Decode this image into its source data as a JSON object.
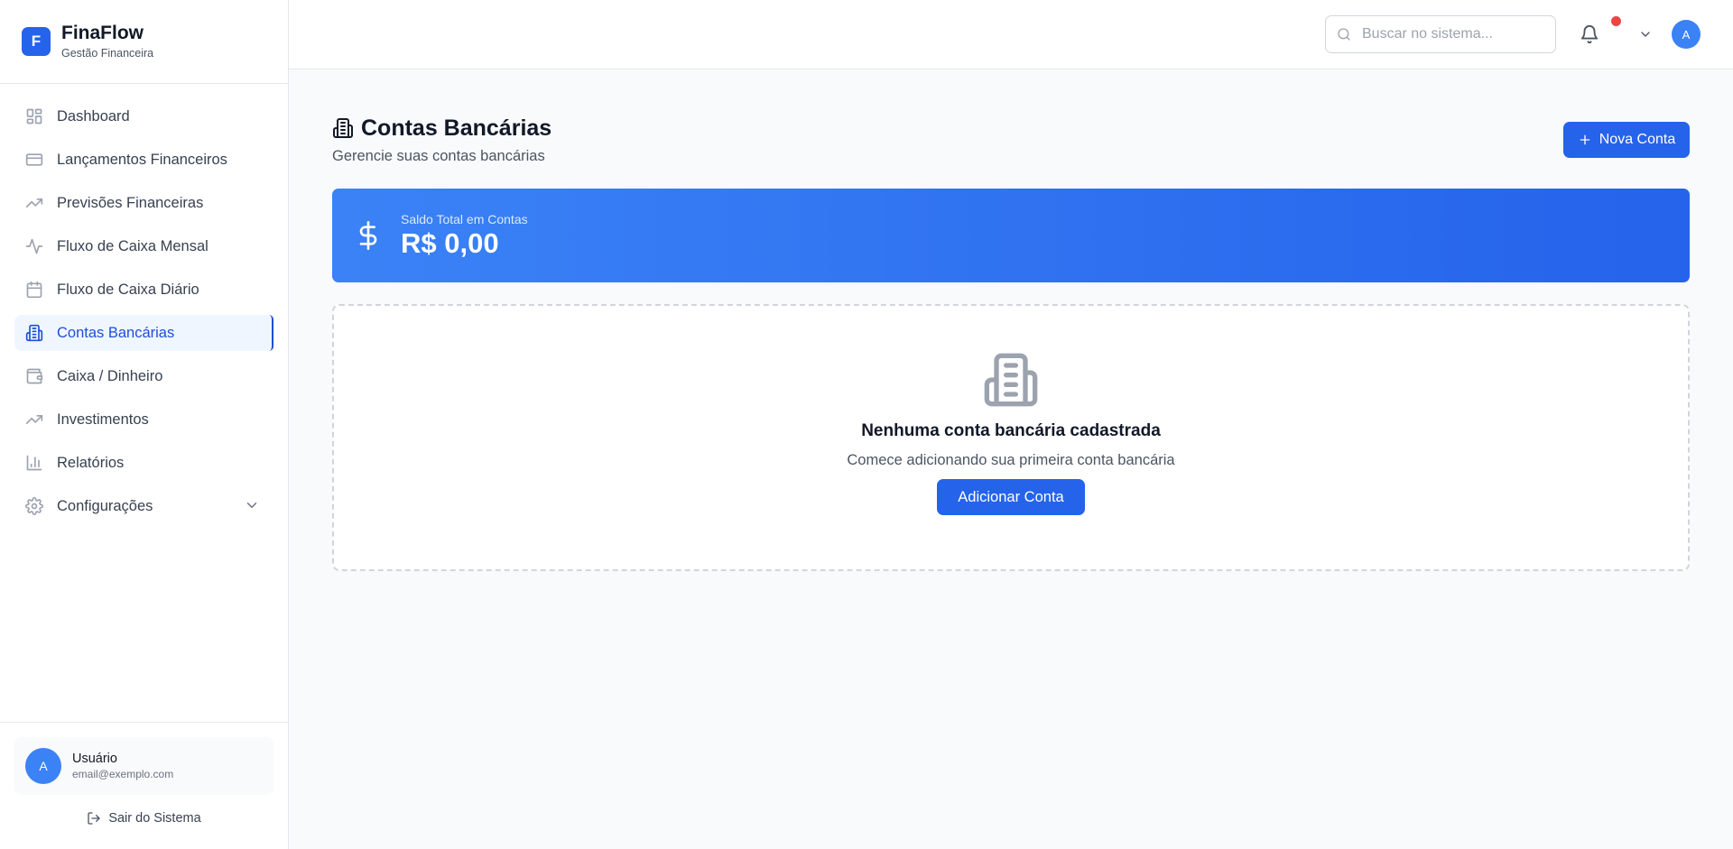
{
  "brand": {
    "logo_letter": "F",
    "name": "FinaFlow",
    "subtitle": "Gestão Financeira"
  },
  "sidebar": {
    "items": [
      {
        "label": "Dashboard",
        "icon": "dashboard-icon"
      },
      {
        "label": "Lançamentos Financeiros",
        "icon": "credit-card-icon"
      },
      {
        "label": "Previsões Financeiras",
        "icon": "trending-up-icon"
      },
      {
        "label": "Fluxo de Caixa Mensal",
        "icon": "activity-icon"
      },
      {
        "label": "Fluxo de Caixa Diário",
        "icon": "calendar-icon"
      },
      {
        "label": "Contas Bancárias",
        "icon": "building-icon",
        "active": true
      },
      {
        "label": "Caixa / Dinheiro",
        "icon": "wallet-icon"
      },
      {
        "label": "Investimentos",
        "icon": "trending-up-icon"
      },
      {
        "label": "Relatórios",
        "icon": "bar-chart-icon"
      },
      {
        "label": "Configurações",
        "icon": "gear-icon",
        "has_submenu": true
      }
    ],
    "user": {
      "avatar_letter": "A",
      "name": "Usuário",
      "email": "email@exemplo.com"
    },
    "logout_label": "Sair do Sistema"
  },
  "header": {
    "search_placeholder": "Buscar no sistema...",
    "avatar_letter": "A",
    "has_notification": true
  },
  "main": {
    "title": "Contas Bancárias",
    "subtitle": "Gerencie suas contas bancárias",
    "new_button_label": "Nova Conta",
    "balance": {
      "label": "Saldo Total em Contas",
      "value": "R$ 0,00"
    },
    "empty_state": {
      "title": "Nenhuma conta bancária cadastrada",
      "subtitle": "Comece adicionando sua primeira conta bancária",
      "button_label": "Adicionar Conta"
    }
  },
  "colors": {
    "accent": "#2563eb",
    "active_bg": "#eff6ff",
    "notification": "#ef4444"
  }
}
